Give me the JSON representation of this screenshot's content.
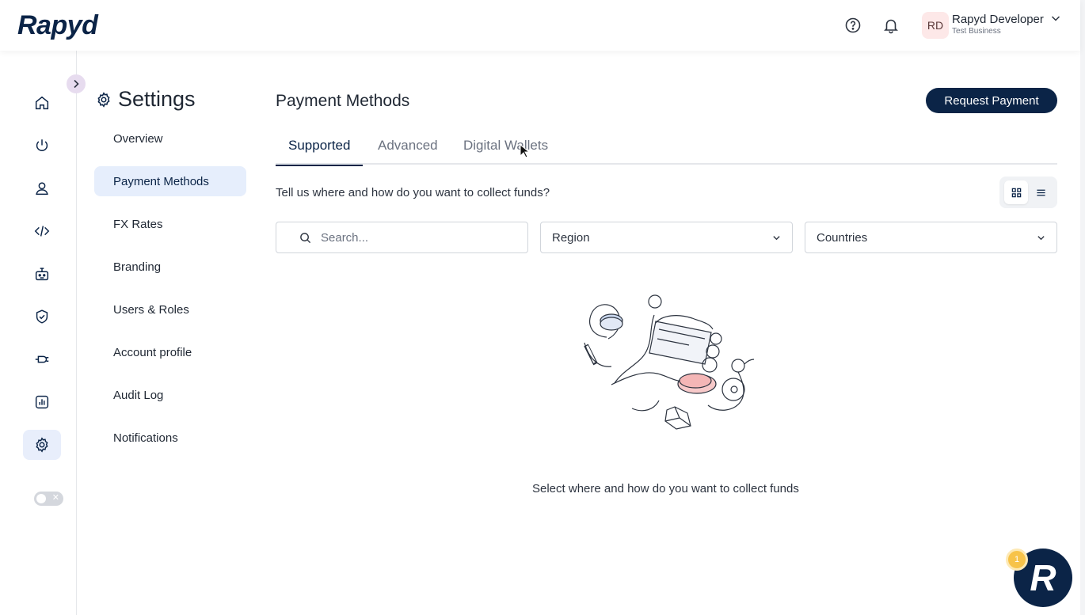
{
  "header": {
    "logo_text": "Rapyd",
    "user": {
      "initials": "RD",
      "name": "Rapyd Developer",
      "business": "Test Business"
    },
    "icons": [
      "help-circle-icon",
      "bell-icon",
      "chevron-down-icon"
    ]
  },
  "rail": {
    "items": [
      "home-icon",
      "power-icon",
      "user-icon",
      "code-icon",
      "robot-icon",
      "shield-check-icon",
      "plug-icon",
      "chart-icon",
      "gear-icon"
    ],
    "active": "gear-icon"
  },
  "settings": {
    "title": "Settings",
    "items": [
      {
        "label": "Overview"
      },
      {
        "label": "Payment Methods"
      },
      {
        "label": "FX Rates"
      },
      {
        "label": "Branding"
      },
      {
        "label": "Users & Roles"
      },
      {
        "label": "Account profile"
      },
      {
        "label": "Audit Log"
      },
      {
        "label": "Notifications"
      }
    ],
    "active": "Payment Methods"
  },
  "main": {
    "title": "Payment Methods",
    "request_button": "Request Payment",
    "tabs": [
      {
        "label": "Supported"
      },
      {
        "label": "Advanced"
      },
      {
        "label": "Digital Wallets"
      }
    ],
    "active_tab": "Supported",
    "subtitle": "Tell us where and how do you want to collect funds?",
    "search": {
      "placeholder": "Search...",
      "value": ""
    },
    "region": {
      "value": "Region"
    },
    "countries": {
      "value": "Countries"
    },
    "empty_text": "Select where and how do you want to collect funds"
  },
  "fab": {
    "letter": "R",
    "badge": "1"
  },
  "colors": {
    "brand": "#0b2447",
    "active_bg": "#e6eefc",
    "badge": "#f7c34a"
  }
}
